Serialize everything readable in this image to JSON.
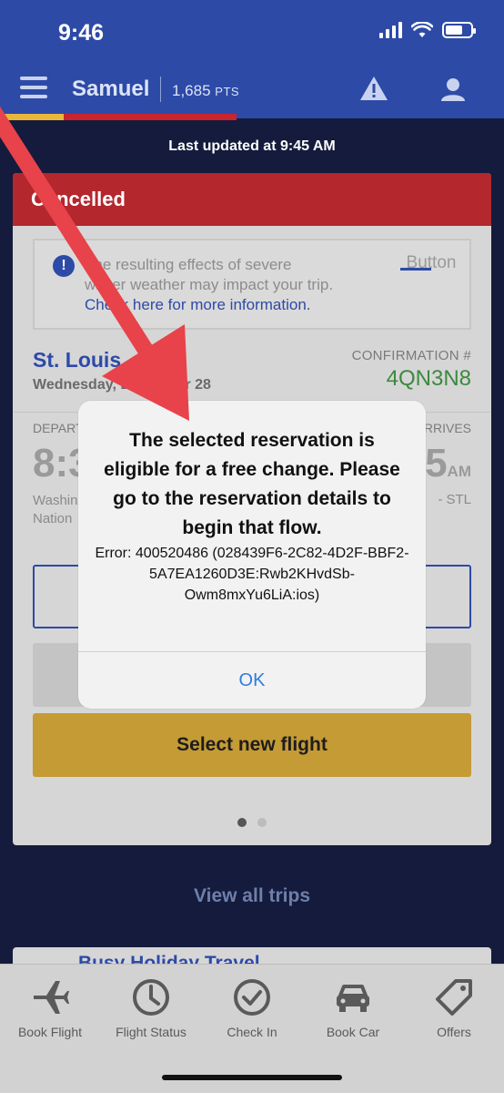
{
  "status_bar": {
    "time": "9:46"
  },
  "header": {
    "user_name": "Samuel",
    "points": "1,685",
    "points_unit": "PTS"
  },
  "last_updated": "Last updated at 9:45 AM",
  "trip_card": {
    "status": "Cancelled",
    "notice": {
      "line1": "The resulting effects of severe",
      "line2": "winter weather may impact your trip.",
      "link": "Check here for more information.",
      "button": "Button"
    },
    "destination": "St. Louis",
    "date": "Wednesday, December 28",
    "confirmation_label": "CONFIRMATION #",
    "confirmation_number": "4QN3N8",
    "depart_label": "DEPARTS",
    "arrive_label": "ARRIVES",
    "depart_time": "8:3",
    "arrive_time": "5",
    "arrive_ampm": "AM",
    "depart_city": "Washington Nation",
    "arrive_city": "- STL",
    "select_button": "Select new flight"
  },
  "view_all": "View all trips",
  "next_card_title": "Busy Holiday Travel",
  "dialog": {
    "title": "The selected reservation is eligible for a free change. Please go to the reservation details to begin that flow.",
    "message": "Error: 400520486 (028439F6-2C82-4D2F-BBF2-5A7EA1260D3E:Rwb2KHvdSb-Owm8mxYu6LiA:ios)",
    "ok": "OK"
  },
  "tabs": [
    {
      "label": "Book Flight",
      "icon": "airplane-icon"
    },
    {
      "label": "Flight Status",
      "icon": "clock-icon"
    },
    {
      "label": "Check In",
      "icon": "check-circle-icon"
    },
    {
      "label": "Book Car",
      "icon": "car-icon"
    },
    {
      "label": "Offers",
      "icon": "tag-icon"
    }
  ],
  "colors": {
    "brand_blue": "#2d4aa7",
    "cancelled_red": "#b3272d",
    "select_gold": "#c49b34",
    "link_blue": "#2f7de1",
    "annotation_red": "#e8424a"
  }
}
